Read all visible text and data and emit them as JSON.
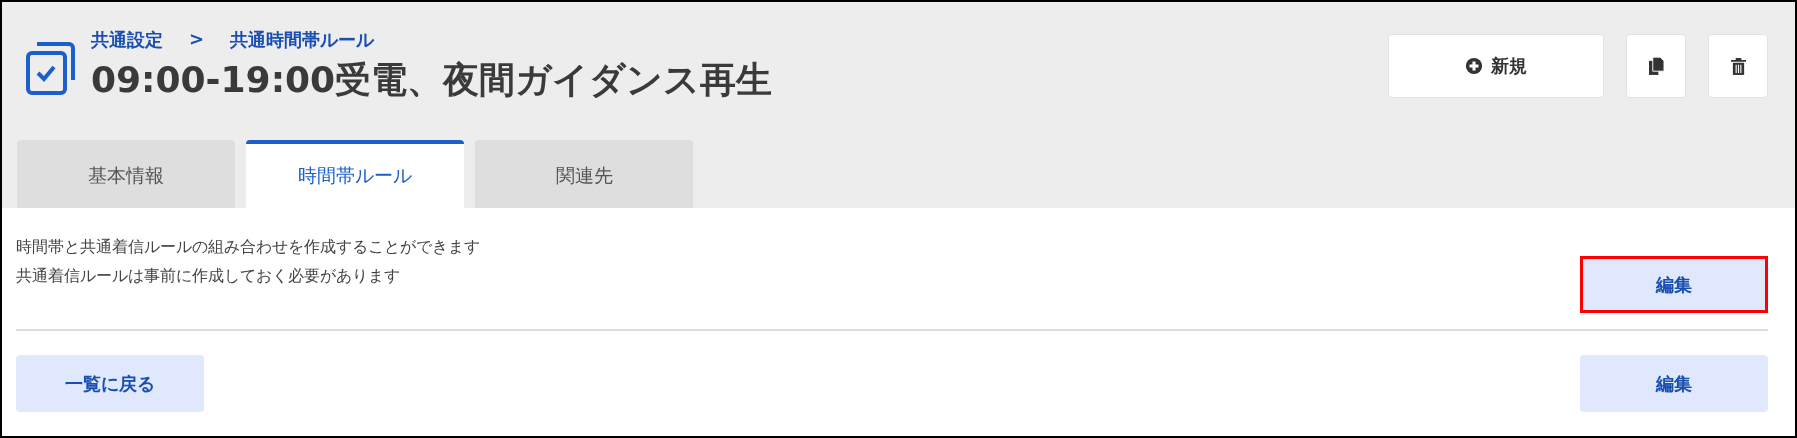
{
  "breadcrumb": [
    "共通設定",
    ">",
    "共通時間帯ルール"
  ],
  "title": "09:00-19:00受電、夜間ガイダンス再生",
  "actions": {
    "new_label": "新規"
  },
  "tabs": [
    {
      "label": "基本情報",
      "selected": false
    },
    {
      "label": "時間帯ルール",
      "selected": true
    },
    {
      "label": "関連先",
      "selected": false
    }
  ],
  "description": [
    "時間帯と共通着信ルールの組み合わせを作成することができます",
    "共通着信ルールは事前に作成しておく必要があります"
  ],
  "edit_button": {
    "label": "編集",
    "highlighted": true
  },
  "footer": {
    "back_label": "一覧に戻る",
    "edit_label": "編集"
  }
}
